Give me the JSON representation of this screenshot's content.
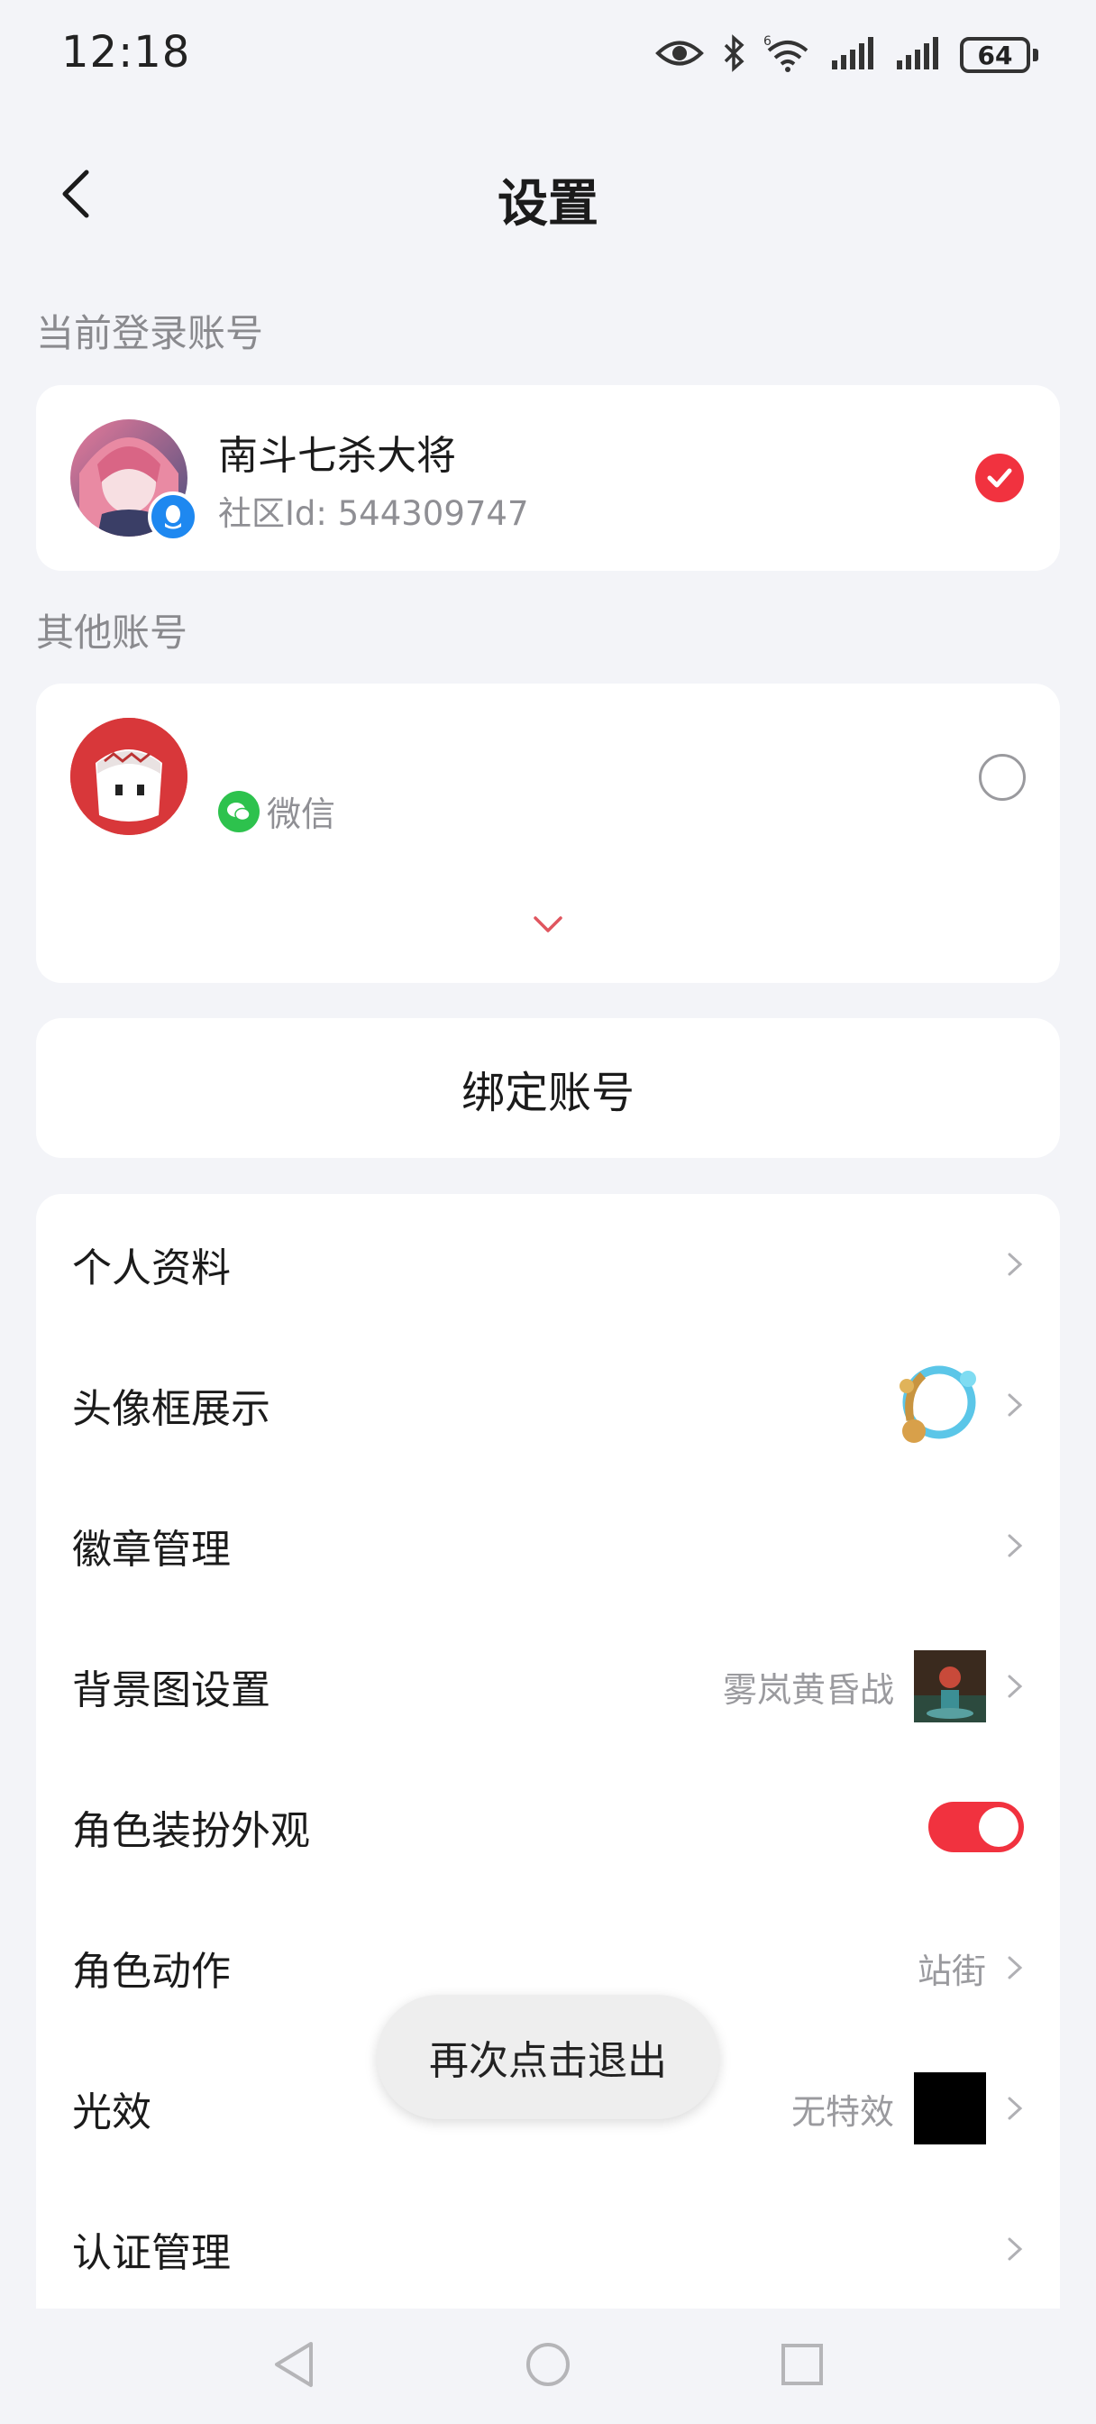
{
  "status_bar": {
    "time": "12:18",
    "battery": "64",
    "wifi_label": "6"
  },
  "header": {
    "title": "设置"
  },
  "current_account": {
    "section_label": "当前登录账号",
    "name": "南斗七杀大将",
    "id_text": "社区Id: 544309747"
  },
  "other_accounts": {
    "section_label": "其他账号",
    "items": [
      {
        "platform": "微信"
      }
    ]
  },
  "bind_button": "绑定账号",
  "menu": [
    {
      "label": "个人资料"
    },
    {
      "label": "头像框展示"
    },
    {
      "label": "徽章管理"
    },
    {
      "label": "背景图设置",
      "value": "雾岚黄昏战"
    },
    {
      "label": "角色装扮外观",
      "toggle_on": true
    },
    {
      "label": "角色动作",
      "value": "站街"
    },
    {
      "label": "光效",
      "value": "无特效"
    },
    {
      "label": "认证管理"
    }
  ],
  "toast": "再次点击退出",
  "colors": {
    "accent": "#f1323f",
    "background": "#f3f4f8",
    "wechat": "#2dc24d"
  }
}
